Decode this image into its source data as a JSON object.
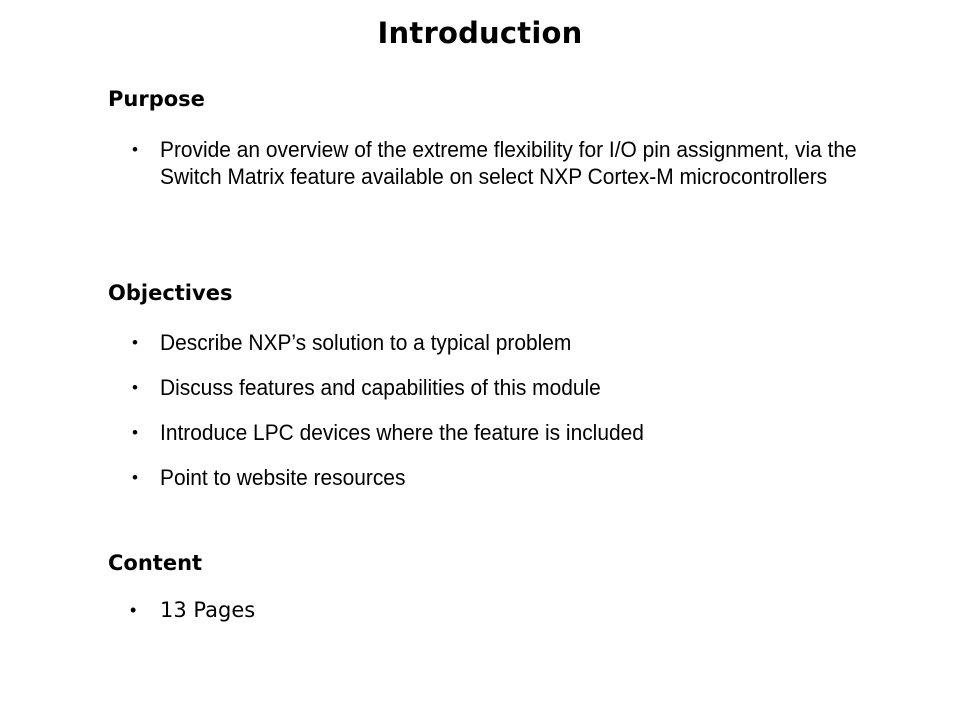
{
  "slide": {
    "title": "Introduction",
    "bullet_glyph": "•",
    "sections": [
      {
        "id": "purpose",
        "heading": "Purpose",
        "bullets": [
          "Provide an overview of the extreme flexibility for I/O pin assignment, via the Switch Matrix feature available on select NXP Cortex-M microcontrollers"
        ]
      },
      {
        "id": "objectives",
        "heading": "Objectives",
        "bullets": [
          "Describe NXP’s solution to a typical problem",
          "Discuss features and capabilities of this module",
          "Introduce LPC devices where the feature is included",
          "Point to website resources"
        ]
      },
      {
        "id": "content",
        "heading": "Content",
        "bullets": [
          "13 Pages"
        ]
      }
    ]
  },
  "colors": {
    "background": "#ffffff",
    "text": "#000000"
  }
}
